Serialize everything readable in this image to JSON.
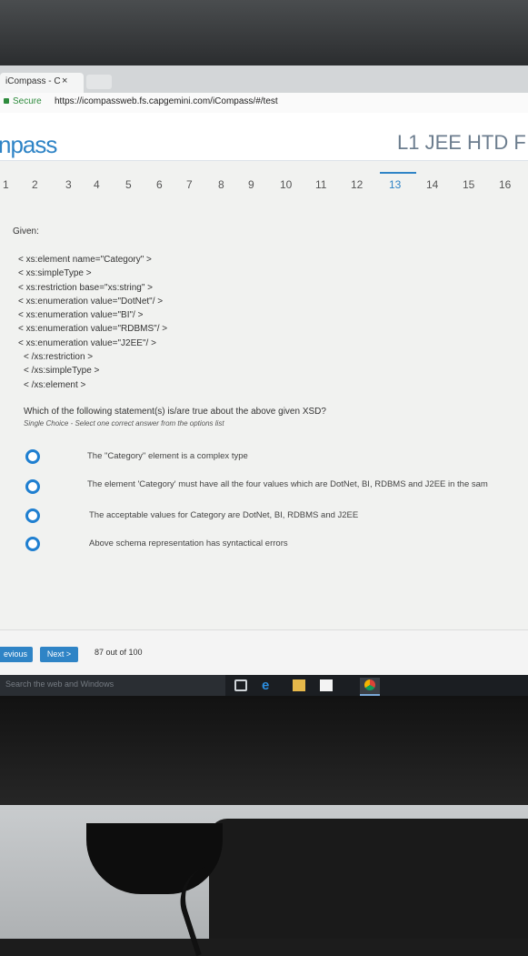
{
  "browser": {
    "tab_title": "iCompass - C",
    "tab_close": "×",
    "secure_label": "Secure",
    "url": "https://icompassweb.fs.capgemini.com/iCompass/#/test"
  },
  "header": {
    "brand": "npass",
    "course": "L1 JEE HTD F"
  },
  "question_nav": {
    "numbers": [
      "1",
      "2",
      "3",
      "4",
      "5",
      "6",
      "7",
      "8",
      "9",
      "10",
      "11",
      "12",
      "13",
      "14",
      "15",
      "16"
    ],
    "active": "13"
  },
  "question": {
    "given_label": "Given:",
    "code_lines": [
      "< xs:element name=\"Category\" >",
      "< xs:simpleType >",
      "< xs:restriction base=\"xs:string\" >",
      "< xs:enumeration value=\"DotNet\"/ >",
      "< xs:enumeration value=\"BI\"/ >",
      "< xs:enumeration value=\"RDBMS\"/ >",
      "< xs:enumeration value=\"J2EE\"/ >",
      "< /xs:restriction >",
      "< /xs:simpleType >",
      "< /xs:element >"
    ],
    "text": "Which of the following statement(s) is/are true about the above given XSD?",
    "mode": "Single Choice - Select one correct answer from the options list",
    "options": [
      "The \"Category\" element is a complex type",
      "The element 'Category' must have all the four values which are DotNet, BI, RDBMS and J2EE in the sam",
      "The acceptable values for Category are DotNet, BI, RDBMS and J2EE",
      "Above schema representation has syntactical errors"
    ]
  },
  "footer": {
    "previous_label": "evious",
    "next_label": "Next >",
    "progress": "87 out of 100"
  },
  "taskbar": {
    "search_placeholder": "Search the web and Windows",
    "icons": [
      "task-view-icon",
      "edge-icon",
      "file-explorer-icon",
      "store-icon",
      "chrome-icon"
    ]
  },
  "colors": {
    "accent": "#2f84c6",
    "radio": "#1f7fd0"
  }
}
